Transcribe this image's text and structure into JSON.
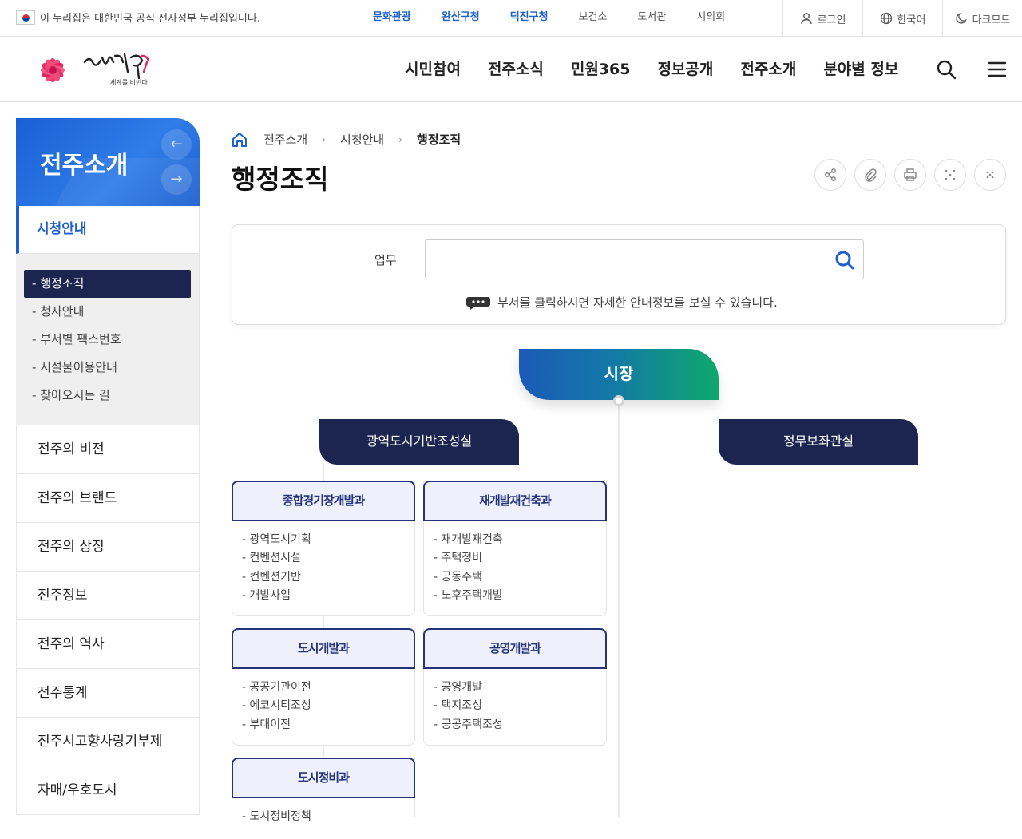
{
  "util": {
    "notice": "이 누리집은 대한민국 공식 전자정부 누리집입니다.",
    "sites": [
      {
        "label": "문화관광",
        "highlight": true
      },
      {
        "label": "완산구청",
        "highlight": true
      },
      {
        "label": "덕진구청",
        "highlight": true
      },
      {
        "label": "보건소",
        "highlight": false
      },
      {
        "label": "도서관",
        "highlight": false
      },
      {
        "label": "시의회",
        "highlight": false
      }
    ],
    "login": "로그인",
    "language": "한국어",
    "darkmode": "다크모드"
  },
  "logo": {
    "sub": "세계를 비빈다"
  },
  "gnb": [
    "시민참여",
    "전주소식",
    "민원365",
    "정보공개",
    "전주소개",
    "분야별 정보"
  ],
  "sidebar": {
    "title": "전주소개",
    "section": "시청안내",
    "sub_items": [
      "행정조직",
      "청사안내",
      "부서별 팩스번호",
      "시설물이용안내",
      "찾아오시는 길"
    ],
    "main_items": [
      "전주의 비전",
      "전주의 브랜드",
      "전주의 상징",
      "전주정보",
      "전주의 역사",
      "전주통계",
      "전주시고향사랑기부제",
      "자매/우호도시"
    ]
  },
  "breadcrumb": [
    "전주소개",
    "시청안내",
    "행정조직"
  ],
  "page": {
    "title": "행정조직"
  },
  "search": {
    "label": "업무",
    "value": "",
    "hint": "부서를 클릭하시면 자세한 안내정보를 보실 수 있습니다."
  },
  "org": {
    "top": "시장",
    "offices": [
      "광역도시기반조성실",
      "정무보좌관실"
    ],
    "departments": [
      {
        "name": "종합경기장개발과",
        "tasks": [
          "광역도시기획",
          "컨벤션시설",
          "컨벤션기반",
          "개발사업"
        ]
      },
      {
        "name": "재개발재건축과",
        "tasks": [
          "재개발재건축",
          "주택정비",
          "공동주택",
          "노후주택개발"
        ]
      },
      {
        "name": "도시개발과",
        "tasks": [
          "공공기관이전",
          "에코시티조성",
          "부대이전"
        ]
      },
      {
        "name": "공영개발과",
        "tasks": [
          "공영개발",
          "택지조성",
          "공공주택조성"
        ]
      },
      {
        "name": "도시정비과",
        "tasks": [
          "도시정비정책"
        ]
      }
    ]
  },
  "colors": {
    "brand_blue": "#1d5fcf",
    "navy": "#1c2450",
    "dept_border": "#25337a",
    "mayor_gradient_end": "#0ea86c"
  }
}
